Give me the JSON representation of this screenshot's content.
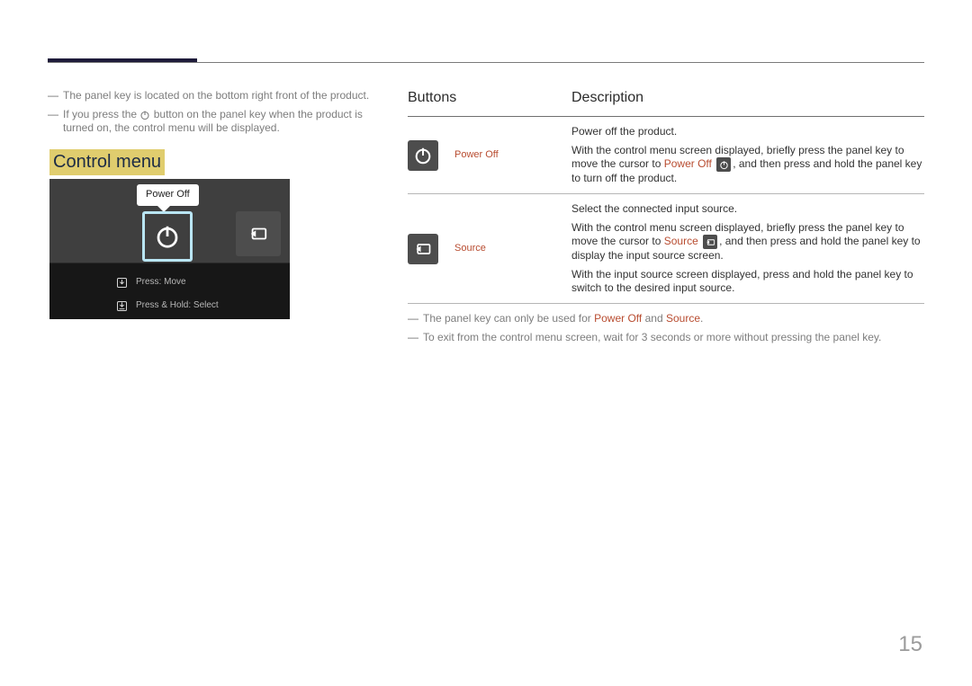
{
  "notes_left": {
    "n1": "The panel key is located on the bottom right front of the product.",
    "n2a": "If you press the ",
    "n2b": " button on the panel key when the product is turned on, the control menu will be displayed."
  },
  "section_title": "Control menu",
  "control_menu": {
    "tooltip": "Power Off",
    "press_move": "Press: Move",
    "press_hold": "Press & Hold: Select"
  },
  "table": {
    "head_buttons": "Buttons",
    "head_desc": "Description",
    "row1_label": "Power Off",
    "row1_p1": "Power off the product.",
    "row1_p2a": "With the control menu screen displayed, briefly press the panel key to move the cursor to ",
    "row1_p2_hl": "Power Off",
    "row1_p2b": ", and then press and hold the panel key to turn off the product.",
    "row2_label": "Source",
    "row2_p1": "Select the connected input source.",
    "row2_p2a": "With the control menu screen displayed, briefly press the panel key to move the cursor to ",
    "row2_p2_hl": "Source",
    "row2_p2b": ", and then press and hold the panel key to display the input source screen.",
    "row2_p3": "With the input source screen displayed, press and hold the panel key to switch to the desired input source."
  },
  "notes_under": {
    "n1a": "The panel key can only be used for ",
    "n1_hl1": "Power Off",
    "n1_mid": " and ",
    "n1_hl2": "Source",
    "n1b": ".",
    "n2": "To exit from the control menu screen, wait for 3 seconds or more without pressing the panel key."
  },
  "page_number": "15",
  "dash": "―"
}
